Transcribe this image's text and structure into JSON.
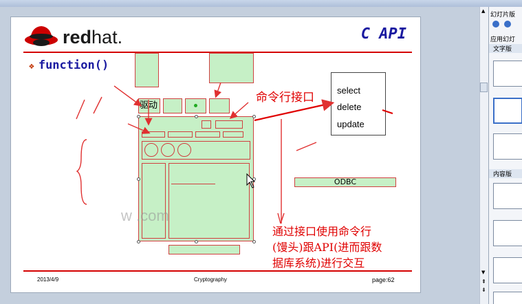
{
  "slide": {
    "logo_text_bold": "red",
    "logo_text_light": "hat.",
    "title": "C API",
    "bullet_symbol": "❖",
    "bullet": "function()",
    "label_driver": "驱动",
    "callout_cli": "命令行接口",
    "commands": [
      "select",
      "delete",
      "update"
    ],
    "odbc": "ODBC",
    "note_lines": [
      "通过接口使用命令行",
      "(馒头)跟API(进而跟数",
      "据库系统)进行交互"
    ],
    "footer_date": "2013/4/9",
    "footer_center": "Cryptography",
    "footer_page": "page:62",
    "watermark": "w                                     .com",
    "colors": {
      "title_blue": "#1a1aa0",
      "accent_red": "#d40000",
      "box_green": "#c6f0c6"
    }
  },
  "task_pane": {
    "title": "幻灯片版",
    "section_apply": "应用幻灯",
    "section_text": "文字版",
    "section_content": "内容版"
  }
}
